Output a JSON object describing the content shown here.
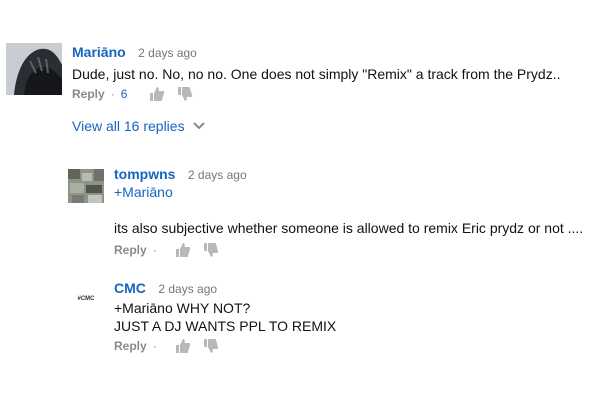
{
  "comments": [
    {
      "author": "Mariāno",
      "time": "2 days ago",
      "text": "Dude, just no. No, no no. One does not simply \"Remix\" a track from the Prydz..",
      "reply_label": "Reply",
      "like_count": "6"
    }
  ],
  "view_replies": {
    "label": "View all 16 replies",
    "icon": "chevron-down-icon"
  },
  "replies": [
    {
      "author": "tompwns",
      "time": "2 days ago",
      "mention": "+Mariāno",
      "text": "its also subjective whether someone is allowed to remix Eric prydz or not ....",
      "reply_label": "Reply"
    },
    {
      "author": "CMC",
      "time": "2 days ago",
      "avatar_text": "#CMC",
      "line1": "+Mariāno WHY NOT?",
      "line2": "JUST A DJ WANTS PPL TO REMIX",
      "reply_label": "Reply"
    }
  ],
  "colors": {
    "link": "#1565c0",
    "muted": "#8a8a8a",
    "text": "#111111"
  }
}
